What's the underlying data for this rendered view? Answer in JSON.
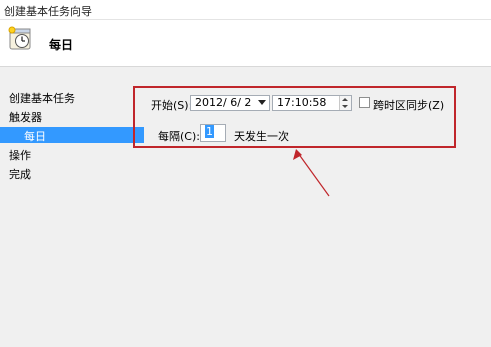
{
  "window": {
    "title": "创建基本任务向导"
  },
  "header": {
    "title": "每日",
    "icon": "clock-task-icon"
  },
  "sidebar": {
    "items": [
      {
        "label": "创建基本任务"
      },
      {
        "label": "触发器"
      },
      {
        "label": "每日",
        "selected": true
      },
      {
        "label": "操作"
      },
      {
        "label": "完成"
      }
    ]
  },
  "form": {
    "start_label": "开始(S):",
    "start_date": "2012/ 6/ 2",
    "start_time": "17:10:58",
    "sync_label": "跨时区同步(Z)",
    "sync_checked": false,
    "recur_label": "每隔(C):",
    "recur_value": "1",
    "recur_suffix": "天发生一次"
  },
  "annotation": {
    "box_color": "#c0262b",
    "arrow_color": "#c0262b"
  },
  "colors": {
    "selection": "#3399ff"
  }
}
